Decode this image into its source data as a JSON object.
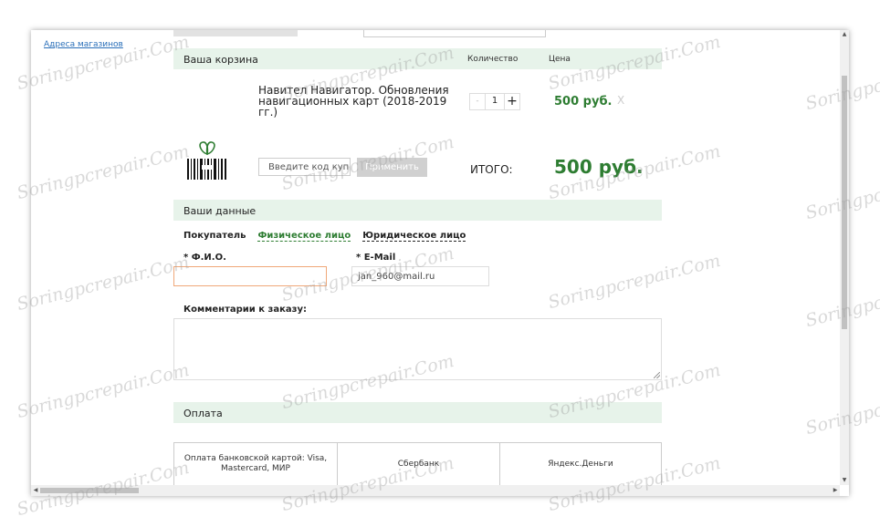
{
  "sidebar": {
    "stores_link": "Адреса магазинов"
  },
  "cart": {
    "title": "Ваша корзина",
    "col_quantity": "Количество",
    "col_price": "Цена",
    "item": {
      "name": "Навител Навигатор. Обновления навигационных карт (2018-2019 гг.)",
      "minus": "-",
      "quantity": "1",
      "plus": "+",
      "price": "500 руб.",
      "remove": "X"
    },
    "coupon_placeholder": "Введите код купона",
    "apply_label": "Применить",
    "total_label": "ИТОГО:",
    "total_amount": "500 руб."
  },
  "customer": {
    "title": "Ваши данные",
    "buyer_label": "Покупатель",
    "tab_individual": "Физическое лицо",
    "tab_legal": "Юридическое лицо",
    "fio_label": "* Ф.И.О.",
    "fio_value": "",
    "email_label": "* E-Mail",
    "email_value": "jan_960@mail.ru",
    "comment_label": "Комментарии к заказу:",
    "comment_value": ""
  },
  "payment": {
    "title": "Оплата",
    "options": [
      "Оплата банковской картой: Visa, Mastercard, МИР",
      "Сбербанк",
      "Яндекс.Деньги"
    ]
  },
  "watermark": "Soringpcrepair.Com",
  "colors": {
    "accent_green": "#2e7d32",
    "band_bg": "#e7f3ea",
    "link_blue": "#2a6fb9",
    "focus_border": "#f0a879"
  }
}
